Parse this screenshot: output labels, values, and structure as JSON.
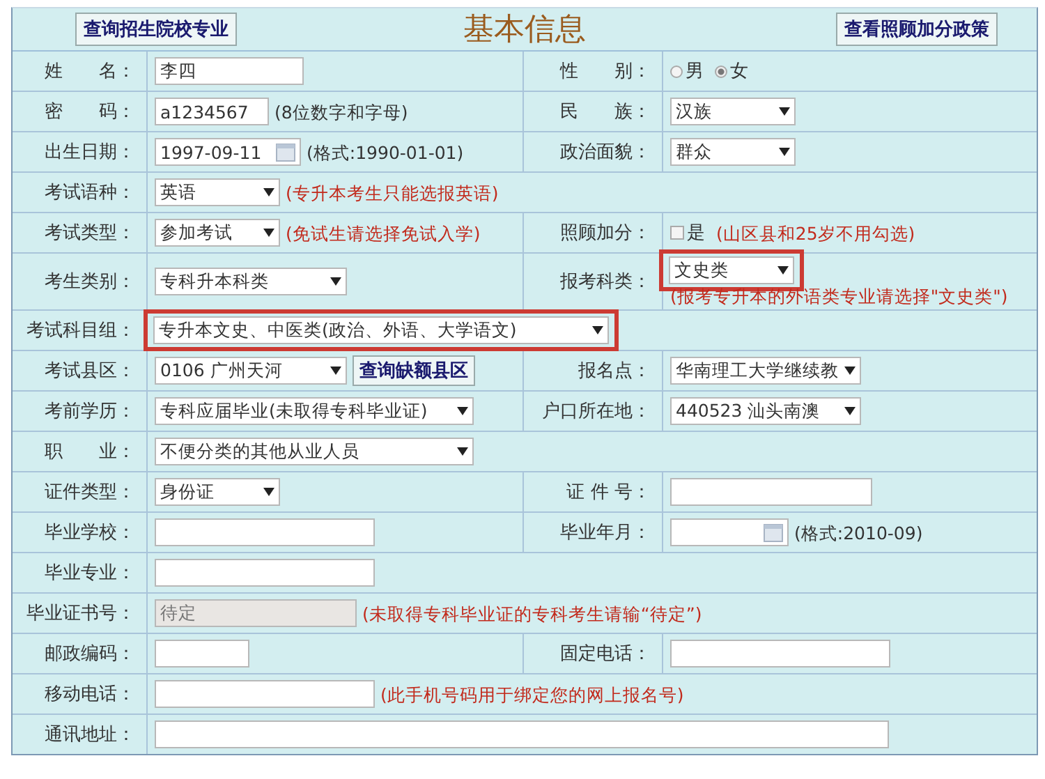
{
  "header": {
    "left_button": "查询招生院校专业",
    "title": "基本信息",
    "right_button": "查看照顾加分政策"
  },
  "rows": [
    {
      "cells": [
        {
          "label": "姓　　名：",
          "controls": [
            {
              "kind": "text",
              "value": "李四"
            }
          ]
        },
        {
          "label": "性　　别：",
          "controls": [
            {
              "kind": "radio",
              "options": [
                {
                  "label": "男",
                  "selected": false
                },
                {
                  "label": "女",
                  "selected": true
                }
              ]
            }
          ]
        }
      ]
    },
    {
      "cells": [
        {
          "label": "密　　码：",
          "controls": [
            {
              "kind": "text",
              "value": "a1234567"
            },
            {
              "kind": "note",
              "text": "(8位数字和字母)",
              "warning": false
            }
          ]
        },
        {
          "label": "民　　族：",
          "controls": [
            {
              "kind": "select",
              "value": "汉族",
              "highlighted": false
            }
          ]
        }
      ]
    },
    {
      "cells": [
        {
          "label": "出生日期：",
          "controls": [
            {
              "kind": "date",
              "value": "1997-09-11"
            },
            {
              "kind": "note",
              "text": "(格式:1990-01-01)",
              "warning": false
            }
          ]
        },
        {
          "label": "政治面貌：",
          "controls": [
            {
              "kind": "select",
              "value": "群众",
              "highlighted": false
            }
          ]
        }
      ]
    },
    {
      "cells": [
        {
          "label": "考试语种：",
          "controls": [
            {
              "kind": "select",
              "value": "英语",
              "highlighted": false
            },
            {
              "kind": "note",
              "text": "(专升本考生只能选报英语)",
              "warning": true
            }
          ]
        }
      ]
    },
    {
      "cells": [
        {
          "label": "考试类型：",
          "controls": [
            {
              "kind": "select",
              "value": "参加考试",
              "highlighted": false
            },
            {
              "kind": "note",
              "text": "(免试生请选择免试入学)",
              "warning": true
            }
          ]
        },
        {
          "label": "照顾加分：",
          "controls": [
            {
              "kind": "checkbox",
              "label": "是",
              "checked": false
            },
            {
              "kind": "note",
              "text": "(山区县和25岁不用勾选)",
              "warning": true
            }
          ]
        }
      ]
    },
    {
      "cells": [
        {
          "label": "考生类别：",
          "controls": [
            {
              "kind": "select",
              "value": "专科升本科类",
              "highlighted": false
            }
          ]
        },
        {
          "label": "报考科类：",
          "controls": [
            {
              "kind": "select",
              "value": "文史类",
              "highlighted": true
            },
            {
              "kind": "note",
              "text": "(报考专升本的外语类专业请选择\"文史类\")",
              "warning": true
            }
          ]
        }
      ]
    },
    {
      "cells": [
        {
          "label": "考试科目组：",
          "controls": [
            {
              "kind": "select",
              "value": "专升本文史、中医类(政治、外语、大学语文)",
              "highlighted": true
            }
          ]
        }
      ]
    },
    {
      "cells": [
        {
          "label": "考试县区：",
          "controls": [
            {
              "kind": "select",
              "value": "0106 广州天河",
              "highlighted": false
            },
            {
              "kind": "button",
              "label": "查询缺额县区"
            }
          ]
        },
        {
          "label": "报名点：",
          "controls": [
            {
              "kind": "select",
              "value": "华南理工大学继续教",
              "highlighted": false
            }
          ]
        }
      ]
    },
    {
      "cells": [
        {
          "label": "考前学历：",
          "controls": [
            {
              "kind": "select",
              "value": "专科应届毕业(未取得专科毕业证)",
              "highlighted": false
            }
          ]
        },
        {
          "label": "户口所在地：",
          "controls": [
            {
              "kind": "select",
              "value": "440523 汕头南澳",
              "highlighted": false
            }
          ]
        }
      ]
    },
    {
      "cells": [
        {
          "label": "职　　业：",
          "controls": [
            {
              "kind": "select",
              "value": "不便分类的其他从业人员",
              "highlighted": false
            }
          ]
        }
      ]
    },
    {
      "cells": [
        {
          "label": "证件类型：",
          "controls": [
            {
              "kind": "select",
              "value": "身份证",
              "highlighted": false
            }
          ]
        },
        {
          "label": "证 件 号：",
          "controls": [
            {
              "kind": "text"
            }
          ]
        }
      ]
    },
    {
      "cells": [
        {
          "label": "毕业学校：",
          "controls": [
            {
              "kind": "text"
            }
          ]
        },
        {
          "label": "毕业年月：",
          "controls": [
            {
              "kind": "date"
            },
            {
              "kind": "note",
              "text": "(格式:2010-09)",
              "warning": false
            }
          ]
        }
      ]
    },
    {
      "cells": [
        {
          "label": "毕业专业：",
          "controls": [
            {
              "kind": "text"
            }
          ]
        }
      ]
    },
    {
      "cells": [
        {
          "label": "毕业证书号：",
          "controls": [
            {
              "kind": "text",
              "value": "待定",
              "disabled": true
            },
            {
              "kind": "note",
              "text": "(未取得专科毕业证的专科考生请输“待定”)",
              "warning": true
            }
          ]
        }
      ]
    },
    {
      "cells": [
        {
          "label": "邮政编码：",
          "controls": [
            {
              "kind": "text"
            }
          ]
        },
        {
          "label": "固定电话：",
          "controls": [
            {
              "kind": "text"
            }
          ]
        }
      ]
    },
    {
      "cells": [
        {
          "label": "移动电话：",
          "controls": [
            {
              "kind": "text"
            },
            {
              "kind": "note",
              "text": "(此手机号码用于绑定您的网上报名号)",
              "warning": true
            }
          ]
        }
      ]
    },
    {
      "cells": [
        {
          "label": "通讯地址：",
          "controls": [
            {
              "kind": "text"
            }
          ]
        }
      ]
    }
  ]
}
